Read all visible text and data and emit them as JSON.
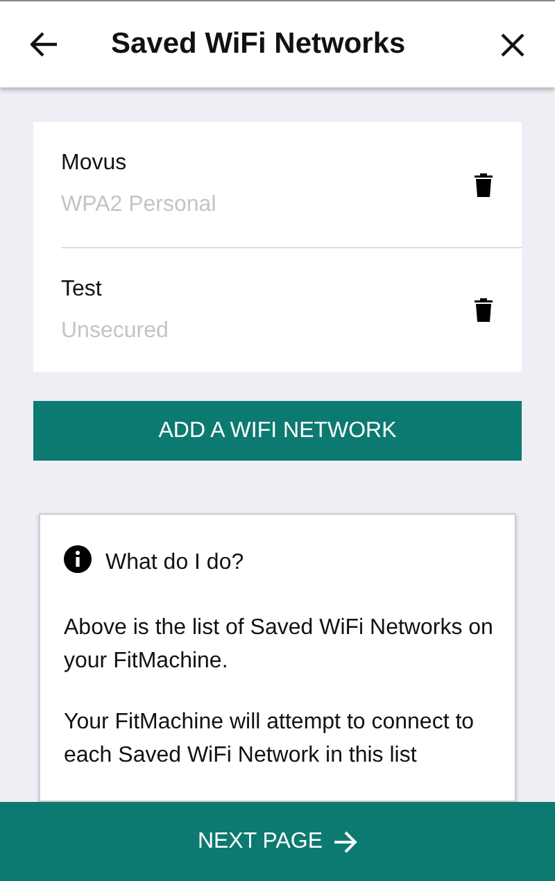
{
  "header": {
    "title": "Saved WiFi Networks"
  },
  "networks": [
    {
      "name": "Movus",
      "security": "WPA2 Personal"
    },
    {
      "name": "Test",
      "security": "Unsecured"
    }
  ],
  "add_button": "ADD A WIFI NETWORK",
  "info": {
    "title": "What do I do?",
    "paragraphs": [
      "Above is the list of Saved WiFi Networks on your FitMachine.",
      "Your FitMachine will attempt to connect to each Saved WiFi Network in this list"
    ]
  },
  "next_button": "NEXT PAGE"
}
